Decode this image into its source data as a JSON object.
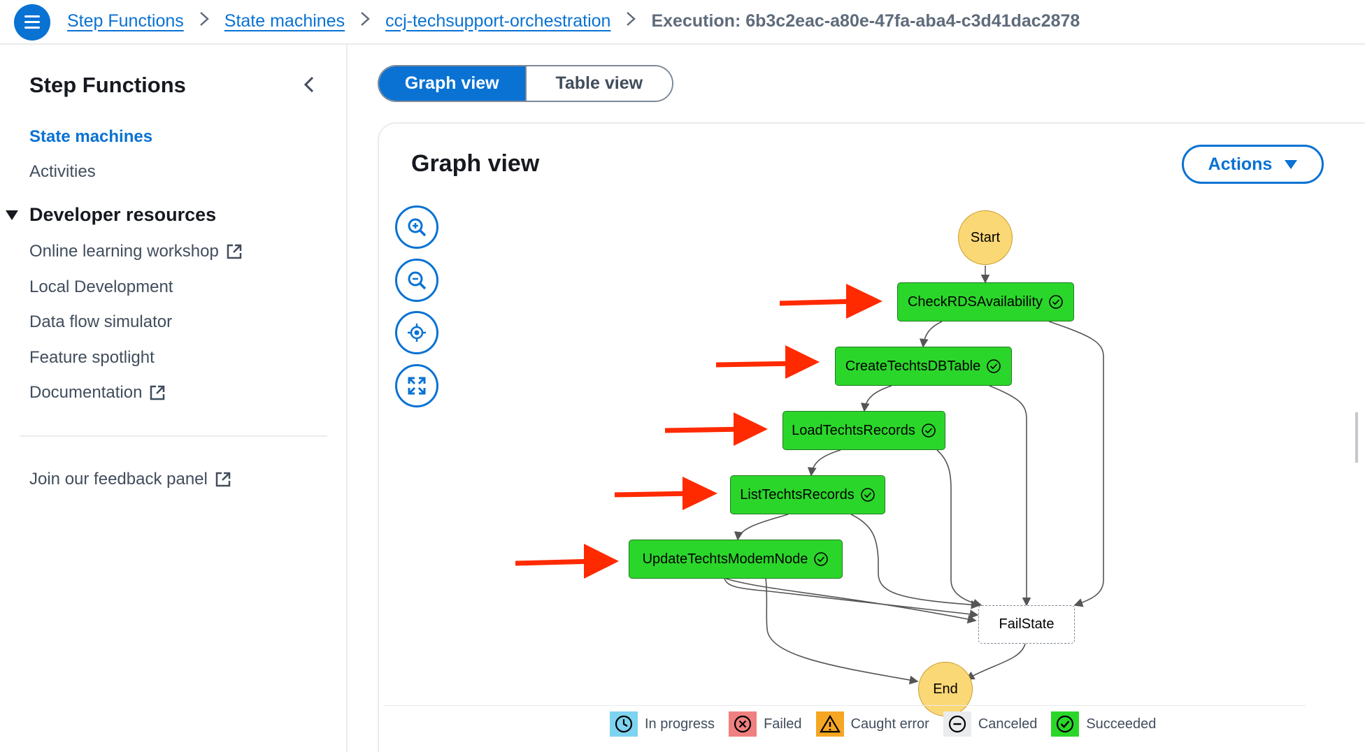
{
  "breadcrumbs": {
    "items": [
      "Step Functions",
      "State machines",
      "ccj-techsupport-orchestration"
    ],
    "current": "Execution: 6b3c2eac-a80e-47fa-aba4-c3d41dac2878"
  },
  "sidebar": {
    "title": "Step Functions",
    "nav": [
      "State machines",
      "Activities"
    ],
    "active": "State machines",
    "section": "Developer resources",
    "resources": [
      "Online learning workshop",
      "Local Development",
      "Data flow simulator",
      "Feature spotlight",
      "Documentation"
    ],
    "feedback": "Join our feedback panel"
  },
  "view_toggle": {
    "graph": "Graph view",
    "table": "Table view",
    "selected": "Graph view"
  },
  "panel": {
    "title": "Graph view",
    "actions": "Actions"
  },
  "graph": {
    "start": "Start",
    "end": "End",
    "fail": "FailState",
    "states": [
      "CheckRDSAvailability",
      "CreateTechtsDBTable",
      "LoadTechtsRecords",
      "ListTechtsRecords",
      "UpdateTechtsModemNode"
    ],
    "status": "Succeeded"
  },
  "legend": [
    "In progress",
    "Failed",
    "Caught error",
    "Canceled",
    "Succeeded"
  ],
  "colors": {
    "accent": "#0972d3",
    "succeeded": "#2bd62b",
    "terminal": "#fbd876",
    "in_progress": "#7dd3f0",
    "failed": "#f08080",
    "caught_error": "#f5a623",
    "canceled": "#e9ebed",
    "annotation_arrow": "#ff2a00"
  }
}
